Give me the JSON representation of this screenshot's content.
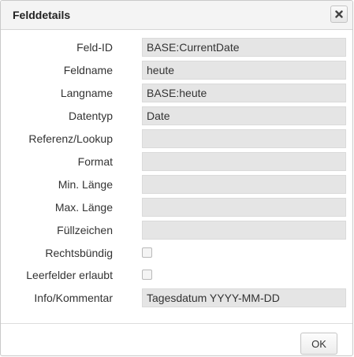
{
  "dialog": {
    "title": "Felddetails",
    "close_icon": "close-x-icon",
    "ok_label": "OK"
  },
  "fields": [
    {
      "label": "Feld-ID",
      "value": "BASE:CurrentDate"
    },
    {
      "label": "Feldname",
      "value": "heute"
    },
    {
      "label": "Langname",
      "value": "BASE:heute"
    },
    {
      "label": "Datentyp",
      "value": "Date"
    },
    {
      "label": "Referenz/Lookup",
      "value": ""
    },
    {
      "label": "Format",
      "value": ""
    },
    {
      "label": "Min. Länge",
      "value": ""
    },
    {
      "label": "Max. Länge",
      "value": ""
    },
    {
      "label": "Füllzeichen",
      "value": ""
    }
  ],
  "checkboxes": [
    {
      "label": "Rechtsbündig",
      "checked": false
    },
    {
      "label": "Leerfelder erlaubt",
      "checked": false
    }
  ],
  "comment": {
    "label": "Info/Kommentar",
    "value": "Tagesdatum YYYY-MM-DD"
  }
}
